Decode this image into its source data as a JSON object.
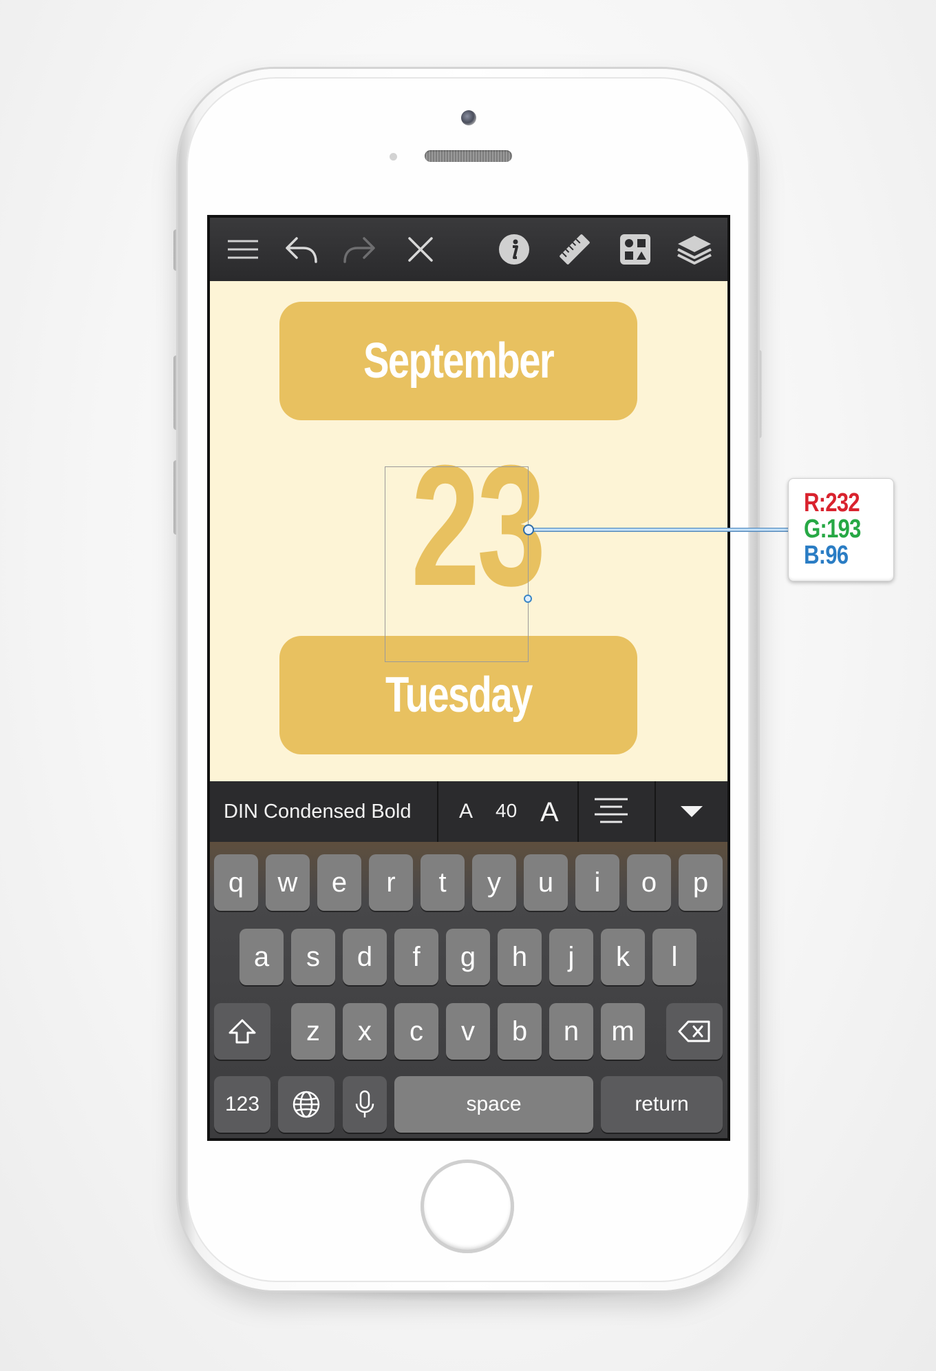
{
  "toolbar": {
    "buttons": [
      {
        "name": "menu-icon"
      },
      {
        "name": "undo-icon"
      },
      {
        "name": "redo-icon"
      },
      {
        "name": "close-icon"
      },
      {
        "name": "info-icon"
      },
      {
        "name": "ruler-icon"
      },
      {
        "name": "shapes-icon"
      },
      {
        "name": "layers-icon"
      }
    ]
  },
  "canvas": {
    "month": "September",
    "day_number": "23",
    "weekday": "Tuesday",
    "accent_color": "#e8c160",
    "background_color": "#fdf4d6"
  },
  "format_bar": {
    "font_name": "DIN Condensed Bold",
    "size_decrease_label": "A",
    "font_size": "40",
    "size_increase_label": "A",
    "align_icon": "align-center-icon",
    "collapse_icon": "chevron-down-icon"
  },
  "keyboard": {
    "row1": [
      "q",
      "w",
      "e",
      "r",
      "t",
      "y",
      "u",
      "i",
      "o",
      "p"
    ],
    "row2": [
      "a",
      "s",
      "d",
      "f",
      "g",
      "h",
      "j",
      "k",
      "l"
    ],
    "row3": [
      "z",
      "x",
      "c",
      "v",
      "b",
      "n",
      "m"
    ],
    "numbers_label": "123",
    "space_label": "space",
    "return_label": "return",
    "shift_icon": "shift-icon",
    "delete_icon": "backspace-icon",
    "globe_icon": "globe-icon",
    "mic_icon": "microphone-icon"
  },
  "color_readout": {
    "r": "R:232",
    "g": "G:193",
    "b": "B:96",
    "r_color": "#d9232e",
    "g_color": "#27a845",
    "b_color": "#2b7dc4"
  }
}
